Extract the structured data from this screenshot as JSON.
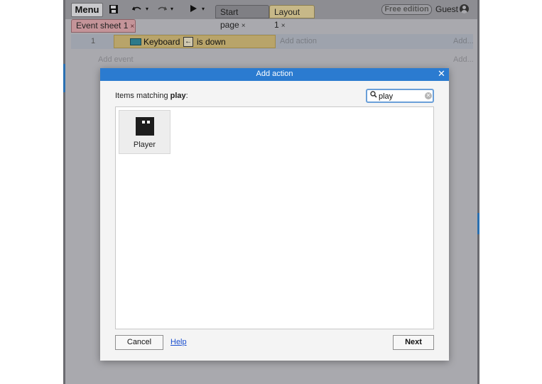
{
  "toolbar": {
    "menu_label": "Menu",
    "icons": [
      "save-icon",
      "undo-icon",
      "redo-icon",
      "play-icon"
    ],
    "tabs": [
      {
        "label": "Start page",
        "close": "×"
      },
      {
        "label": "Layout 1",
        "close": "×"
      }
    ],
    "edition_badge": "Free edition",
    "user_label": "Guest"
  },
  "event_sheet": {
    "tab_label": "Event sheet 1",
    "tab_close": "×",
    "row_number": "1",
    "condition_object": "Keyboard",
    "condition_key_glyph": "←",
    "condition_text": "is down",
    "add_action_inline": "Add action",
    "add_more_1": "Add...",
    "add_event": "Add event",
    "add_more_2": "Add..."
  },
  "dialog": {
    "title": "Add action",
    "close": "✕",
    "match_prefix": "Items matching ",
    "match_term": "play",
    "match_suffix": ":",
    "search_value": "play",
    "items": [
      {
        "label": "Player",
        "icon": "sprite-icon"
      }
    ],
    "cancel_label": "Cancel",
    "help_label": "Help",
    "next_label": "Next"
  },
  "colors": {
    "header_blue": "#2b7bd0",
    "condition_yellow": "#b8a46a",
    "event_sheet_tab": "#c49499",
    "layout_tab": "#c7b888"
  }
}
